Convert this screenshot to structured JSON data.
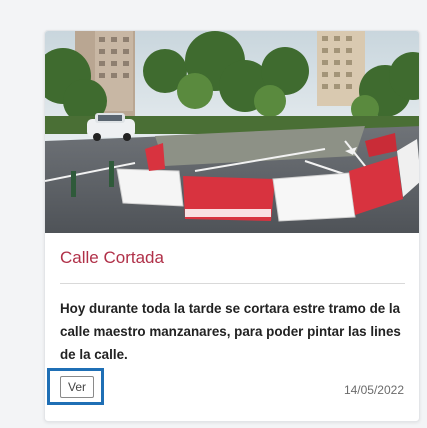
{
  "card": {
    "title": "Calle Cortada",
    "title_color": "#b03048",
    "description": "Hoy durante toda la tarde se cortara estre tramo de la calle maestro manzanares, para poder pintar las lines de la calle.",
    "button_label": "Ver",
    "date": "14/05/2022",
    "focus_color": "#1f6fb5",
    "image": {
      "subject": "street-closure-photo"
    }
  }
}
